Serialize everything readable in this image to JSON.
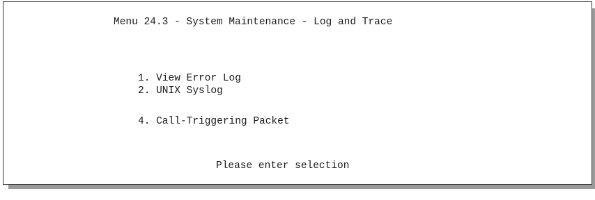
{
  "screen": {
    "title": "Menu 24.3 - System Maintenance - Log and Trace",
    "menu_items": [
      {
        "label": "1. View Error Log"
      },
      {
        "label": "2. UNIX Syslog"
      },
      {
        "label": "4. Call-Triggering Packet"
      }
    ],
    "prompt": "Please enter selection"
  }
}
